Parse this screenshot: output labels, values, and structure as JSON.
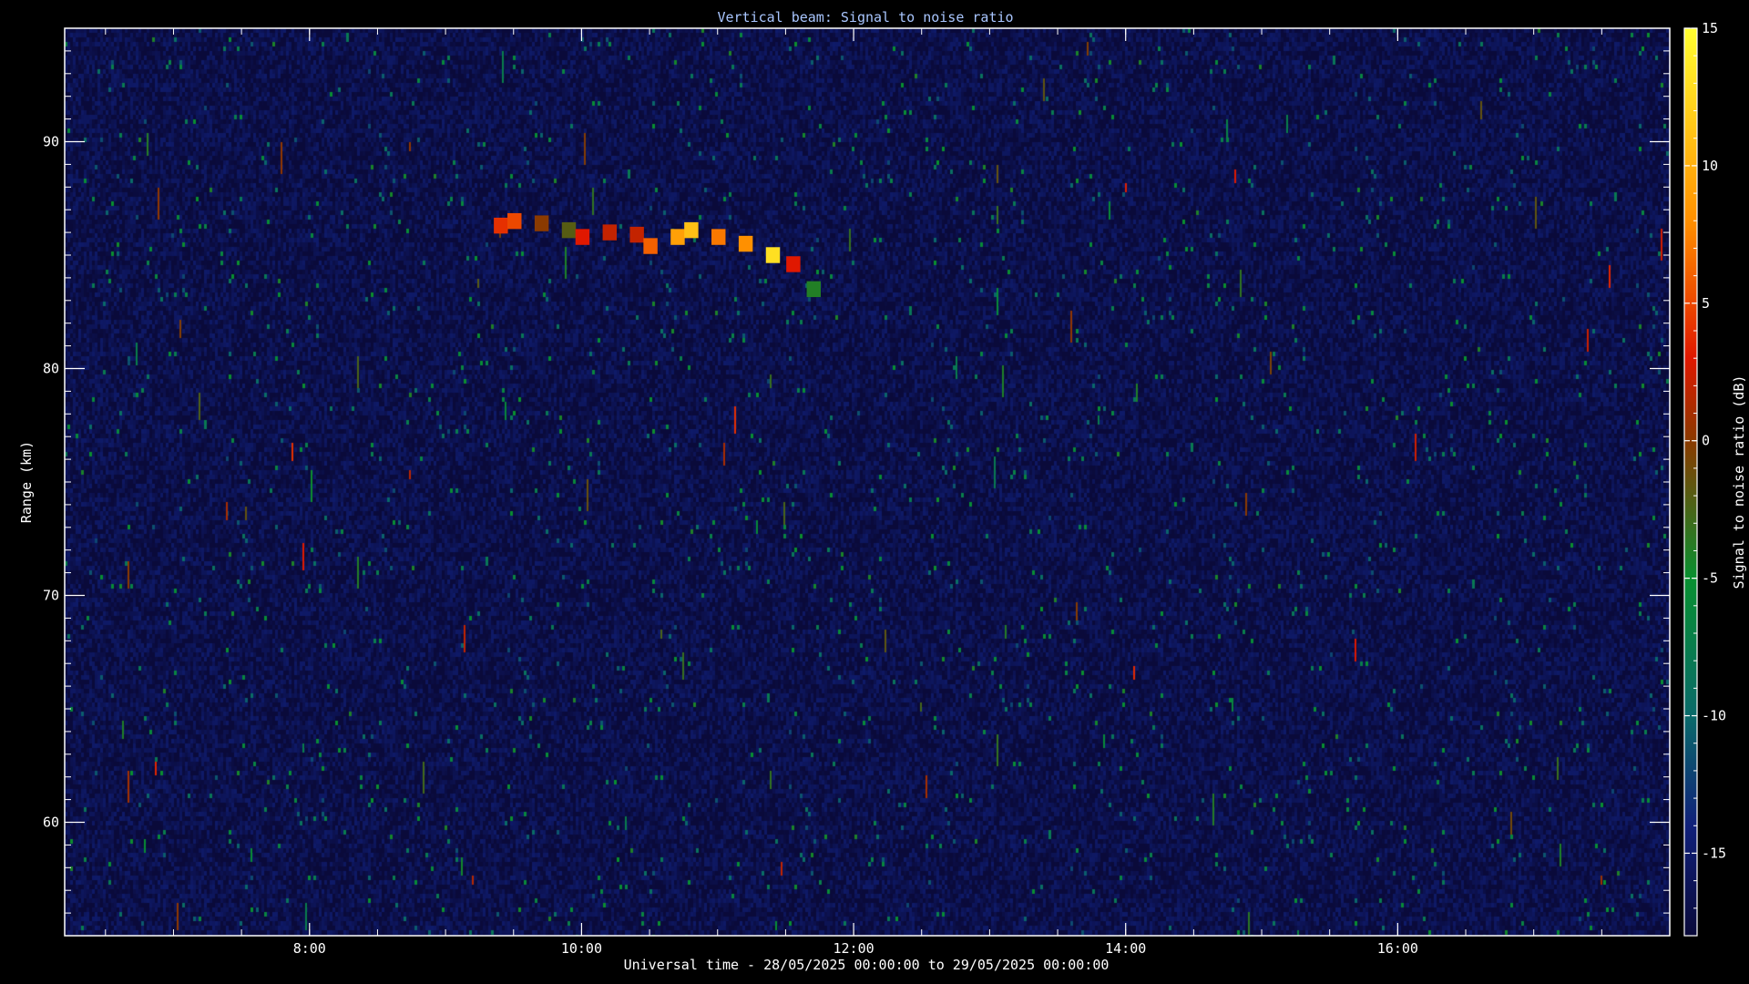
{
  "chart_data": {
    "type": "heatmap",
    "title": "Vertical beam: Signal to noise ratio",
    "xlabel": "Universal time - 28/05/2025 00:00:00 to 29/05/2025 00:00:00",
    "ylabel": "Range (km)",
    "colorbar_label": "Signal to noise ratio (dB)",
    "xlim_hours": [
      6.2,
      18.0
    ],
    "ylim_km": [
      55,
      95
    ],
    "x_tick_values_hours": [
      8,
      10,
      12,
      14,
      16
    ],
    "x_tick_labels": [
      "8:00",
      "10:00",
      "12:00",
      "14:00",
      "16:00"
    ],
    "y_tick_values": [
      60,
      70,
      80,
      90
    ],
    "y_tick_labels": [
      "60",
      "70",
      "80",
      "90"
    ],
    "colorbar_range_db": [
      -18,
      15
    ],
    "colorbar_tick_values": [
      -15,
      -10,
      -5,
      0,
      5,
      10,
      15
    ],
    "colorbar_tick_labels": [
      "-15",
      "-10",
      "-5",
      "0",
      "5",
      "10",
      "15"
    ],
    "background_db": -17,
    "echo_layer": {
      "description_points": [
        {
          "time_hours": 9.4,
          "range_km": 86.3,
          "snr_db": 4
        },
        {
          "time_hours": 9.5,
          "range_km": 86.5,
          "snr_db": 5
        },
        {
          "time_hours": 9.7,
          "range_km": 86.4,
          "snr_db": 0
        },
        {
          "time_hours": 9.9,
          "range_km": 86.1,
          "snr_db": -2
        },
        {
          "time_hours": 10.0,
          "range_km": 85.8,
          "snr_db": 3
        },
        {
          "time_hours": 10.2,
          "range_km": 86.0,
          "snr_db": 2
        },
        {
          "time_hours": 10.4,
          "range_km": 85.9,
          "snr_db": 2
        },
        {
          "time_hours": 10.5,
          "range_km": 85.4,
          "snr_db": 6
        },
        {
          "time_hours": 10.7,
          "range_km": 85.8,
          "snr_db": 9
        },
        {
          "time_hours": 10.8,
          "range_km": 86.1,
          "snr_db": 11
        },
        {
          "time_hours": 11.0,
          "range_km": 85.8,
          "snr_db": 7
        },
        {
          "time_hours": 11.2,
          "range_km": 85.5,
          "snr_db": 8
        },
        {
          "time_hours": 11.4,
          "range_km": 85.0,
          "snr_db": 13
        },
        {
          "time_hours": 11.55,
          "range_km": 84.6,
          "snr_db": 3
        },
        {
          "time_hours": 11.7,
          "range_km": 83.5,
          "snr_db": -4
        }
      ]
    },
    "colormap_stops": [
      {
        "db": -18,
        "color": "#0a0a3a"
      },
      {
        "db": -14,
        "color": "#10207a"
      },
      {
        "db": -10,
        "color": "#0a6a6a"
      },
      {
        "db": -5,
        "color": "#089030"
      },
      {
        "db": 0,
        "color": "#8a3a00"
      },
      {
        "db": 3,
        "color": "#e01800"
      },
      {
        "db": 8,
        "color": "#ff9000"
      },
      {
        "db": 15,
        "color": "#ffff30"
      }
    ],
    "grid": false
  }
}
